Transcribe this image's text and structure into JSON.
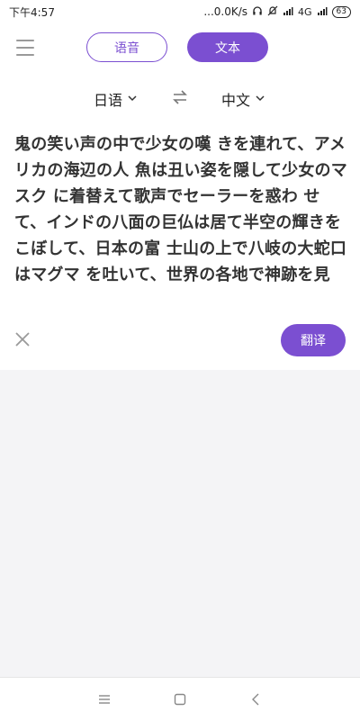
{
  "status_bar": {
    "time": "下午4:57",
    "network_speed": "...0.0K/s",
    "network": "4G",
    "battery": "63"
  },
  "mode_tabs": {
    "voice_label": "语音",
    "text_label": "文本"
  },
  "languages": {
    "source": "日语",
    "target": "中文"
  },
  "source_text": "鬼の笑い声の中で少女の嘆 きを連れて、アメリカの海辺の人 魚は丑い姿を隠して少女のマスク に着替えて歌声でセーラーを惑わ せて、インドの八面の巨仏は居て半空の輝きをこぼして、日本の富 士山の上で八岐の大蛇口はマグマ を吐いて、世界の各地で神跡を見",
  "actions": {
    "translate_label": "翻译"
  },
  "colors": {
    "accent": "#7b4fd1"
  }
}
